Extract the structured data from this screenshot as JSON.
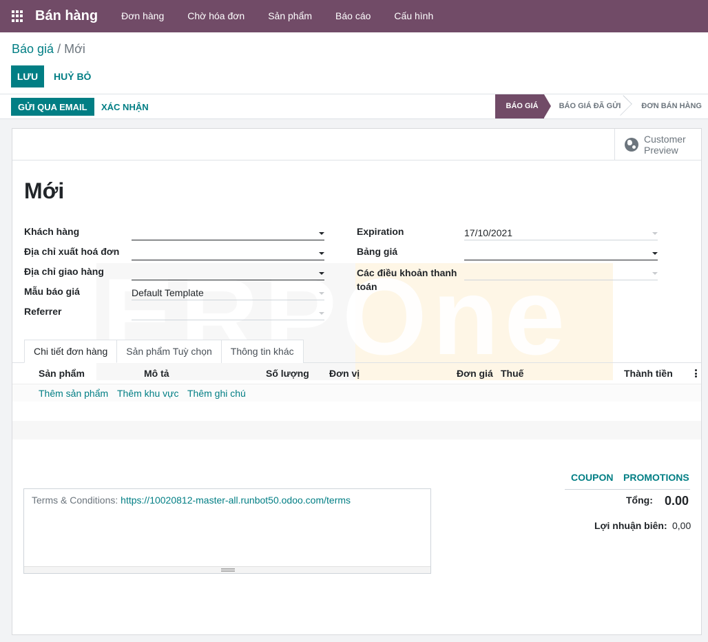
{
  "navbar": {
    "app_title": "Bán hàng",
    "menu": [
      "Đơn hàng",
      "Chờ hóa đơn",
      "Sản phẩm",
      "Báo cáo",
      "Cấu hình"
    ]
  },
  "breadcrumb": {
    "parent": "Báo giá",
    "separator": " / ",
    "current": "Mới"
  },
  "actions": {
    "save": "LƯU",
    "discard": "HUỶ BỎ"
  },
  "statusbar": {
    "send_email": "GỬI QUA EMAIL",
    "confirm": "XÁC NHẬN",
    "stages": [
      "BÁO GIÁ",
      "BÁO GIÁ ĐÃ GỬI",
      "ĐƠN BÁN HÀNG"
    ],
    "active_stage": "BÁO GIÁ"
  },
  "button_box": {
    "preview_line1": "Customer",
    "preview_line2": "Preview"
  },
  "watermark": "ERPOne",
  "form": {
    "title": "Mới",
    "left": {
      "customer_label": "Khách hàng",
      "customer_value": "",
      "invoice_address_label": "Địa chỉ xuất hoá đơn",
      "invoice_address_value": "",
      "delivery_address_label": "Địa chỉ giao hàng",
      "delivery_address_value": "",
      "template_label": "Mẫu báo giá",
      "template_value": "Default Template",
      "referrer_label": "Referrer",
      "referrer_value": ""
    },
    "right": {
      "expiration_label": "Expiration",
      "expiration_value": "17/10/2021",
      "pricelist_label": "Bảng giá",
      "pricelist_value": "",
      "payment_terms_label_1": "Các điều khoản thanh",
      "payment_terms_label_2": "toán",
      "payment_terms_value": ""
    }
  },
  "tabs": [
    "Chi tiết đơn hàng",
    "Sản phẩm Tuỳ chọn",
    "Thông tin khác"
  ],
  "active_tab": "Chi tiết đơn hàng",
  "order_lines": {
    "columns": [
      "Sản phẩm",
      "Mô tả",
      "Số lượng",
      "Đơn vị",
      "Đơn giá",
      "Thuế",
      "Thành tiền"
    ],
    "add_actions": [
      "Thêm sản phẩm",
      "Thêm khu vực",
      "Thêm ghi chú"
    ],
    "rows": []
  },
  "summary": {
    "coupon": "COUPON",
    "promotions": "PROMOTIONS",
    "total_label": "Tổng:",
    "total_value": "0.00",
    "margin_label": "Lợi nhuận biên:",
    "margin_value": "0,00"
  },
  "terms": {
    "prefix": "Terms & Conditions: ",
    "link": "https://10020812-master-all.runbot50.odoo.com/terms"
  },
  "colors": {
    "brand": "#714b67",
    "accent": "#017e84"
  }
}
